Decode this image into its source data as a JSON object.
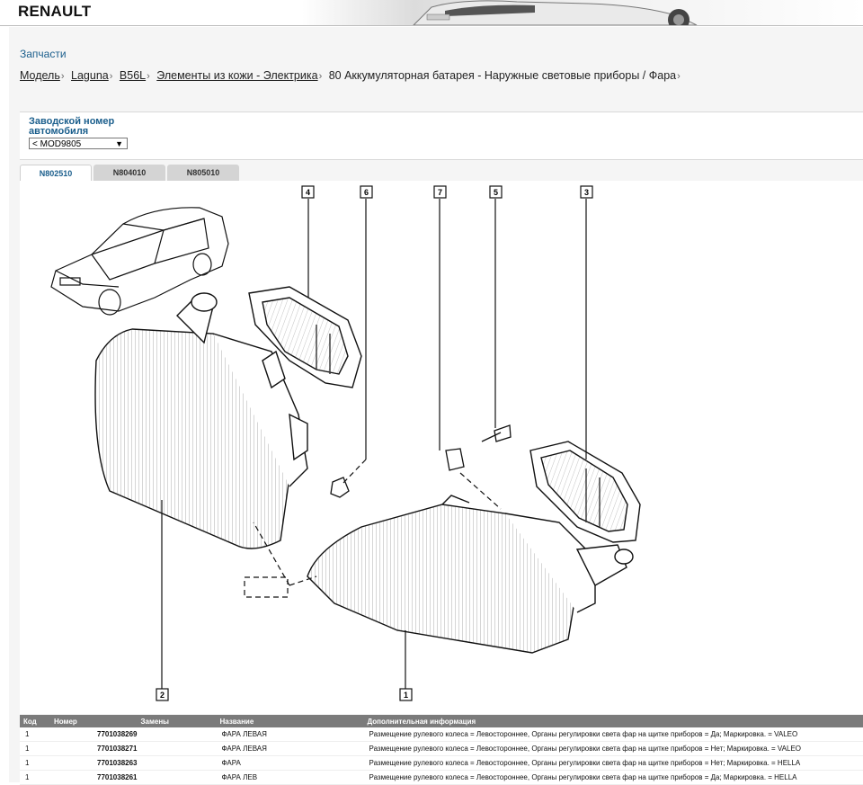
{
  "header": {
    "brand": "RENAULT"
  },
  "page": {
    "section_title": "Запчасти",
    "breadcrumb": [
      {
        "label": "Модель",
        "link": true
      },
      {
        "label": "Laguna",
        "link": true
      },
      {
        "label": "B56L",
        "link": true
      },
      {
        "label": "Элементы из кожи - Электрика",
        "link": true
      },
      {
        "label": "80 Аккумуляторная батарея - Наружные световые приборы / Фара",
        "link": false
      }
    ],
    "breadcrumb_sep": "›"
  },
  "vin": {
    "label": "Заводской номер автомобиля",
    "selected": "< MOD9805",
    "arrow": "▼"
  },
  "tabs": [
    {
      "label": "N802510",
      "active": true
    },
    {
      "label": "N804010",
      "active": false
    },
    {
      "label": "N805010",
      "active": false
    }
  ],
  "diagram": {
    "callouts": [
      "4",
      "6",
      "7",
      "5",
      "3",
      "2",
      "1"
    ]
  },
  "table": {
    "headers": [
      "Код",
      "Номер",
      "Замены",
      "Название",
      "Дополнительная информация"
    ],
    "rows": [
      {
        "code": "1",
        "number": "7701038269",
        "replacements": "",
        "name": "ФАРА ЛЕВАЯ",
        "info": "Размещение рулевого колеса = Левостороннее, Органы регулировки света фар на щитке приборов = Да; Маркировка. = VALEO"
      },
      {
        "code": "1",
        "number": "7701038271",
        "replacements": "",
        "name": "ФАРА ЛЕВАЯ",
        "info": "Размещение рулевого колеса = Левостороннее, Органы регулировки света фар на щитке приборов = Нет; Маркировка. = VALEO"
      },
      {
        "code": "1",
        "number": "7701038263",
        "replacements": "",
        "name": "ФАРА",
        "info": "Размещение рулевого колеса = Левостороннее, Органы регулировки света фар на щитке приборов = Нет; Маркировка. = HELLA"
      },
      {
        "code": "1",
        "number": "7701038261",
        "replacements": "",
        "name": "ФАРА ЛЕВ",
        "info": "Размещение рулевого колеса = Левостороннее, Органы регулировки света фар на щитке приборов = Да; Маркировка. = HELLA"
      }
    ]
  }
}
